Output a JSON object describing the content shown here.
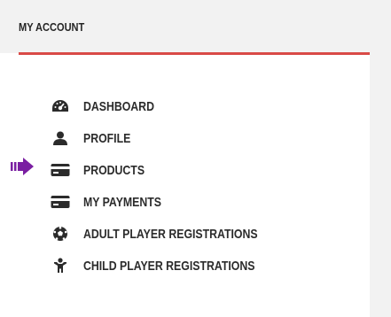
{
  "account": {
    "title": "MY ACCOUNT",
    "accent_color": "#d94a47",
    "pointer_color": "#7a1fa2"
  },
  "menu": {
    "items": [
      {
        "label": "DASHBOARD",
        "icon": "dashboard-gauge-icon"
      },
      {
        "label": "PROFILE",
        "icon": "user-icon"
      },
      {
        "label": "PRODUCTS",
        "icon": "credit-card-icon"
      },
      {
        "label": "MY PAYMENTS",
        "icon": "credit-card-icon"
      },
      {
        "label": "ADULT PLAYER REGISTRATIONS",
        "icon": "soccer-ball-icon"
      },
      {
        "label": "CHILD PLAYER REGISTRATIONS",
        "icon": "child-icon"
      }
    ]
  }
}
